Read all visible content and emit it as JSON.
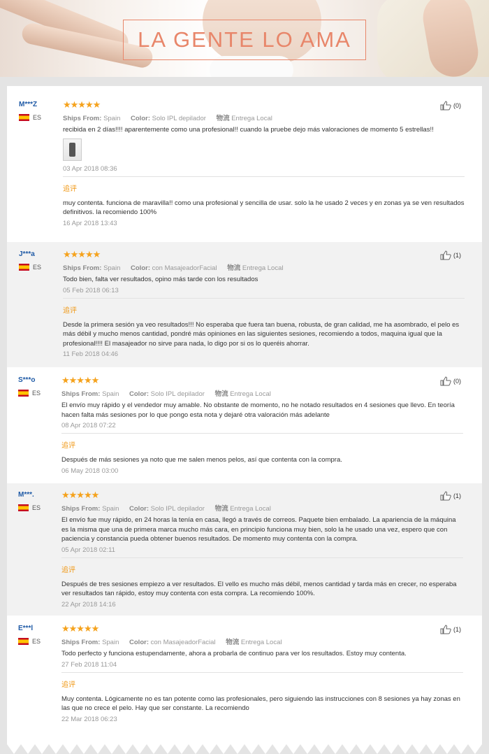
{
  "banner": {
    "title": "LA GENTE LO AMA"
  },
  "labels": {
    "ships_from": "Ships From:",
    "color": "Color:",
    "logistics": "物流",
    "followup": "追评"
  },
  "reviews": [
    {
      "user": "M***Z",
      "country": "ES",
      "stars": "★★★★★",
      "ships_from": "Spain",
      "color": "Solo IPL depilador",
      "logistics": "Entrega Local",
      "text": "recibida en 2 días!!!! aparentemente como una profesional!! cuando la pruebe dejo más valoraciones de momento 5 estrellas!!",
      "date": "03 Apr 2018 08:36",
      "likes": "(0)",
      "followup_text": "muy contenta. funciona de maravilla!! como una profesional y sencilla de usar. solo la he usado 2 veces y en zonas ya se ven resultados definitivos. la recomiendo 100%",
      "followup_date": "16 Apr 2018 13:43"
    },
    {
      "user": "J***a",
      "country": "ES",
      "stars": "★★★★★",
      "ships_from": "Spain",
      "color": "con MasajeadorFacial",
      "logistics": "Entrega Local",
      "text": "Todo bien, falta ver resultados, opino más tarde con los resultados",
      "date": "05 Feb 2018 06:13",
      "likes": "(1)",
      "followup_text": "Desde la primera sesión ya veo resultados!!! No esperaba que fuera tan buena, robusta, de gran calidad, me ha asombrado, el pelo es más débil y mucho menos cantidad, pondré más opiniones en las siguientes sesiones, recomiendo a todos, maquina igual que la profesional!!!! El masajeador no sirve para nada, lo digo por si os lo queréis ahorrar.",
      "followup_date": "11 Feb 2018 04:46"
    },
    {
      "user": "S***o",
      "country": "ES",
      "stars": "★★★★★",
      "ships_from": "Spain",
      "color": "Solo IPL depilador",
      "logistics": "Entrega Local",
      "text": "El envío muy rápido y el vendedor muy amable. No obstante de momento, no he notado resultados en 4 sesiones que llevo. En teoría hacen falta más sesiones por lo que pongo esta nota y dejaré otra valoración más adelante",
      "date": "08 Apr 2018 07:22",
      "likes": "(0)",
      "followup_text": "Después de más sesiones ya noto que me salen menos pelos, así que contenta con la compra.",
      "followup_date": "06 May 2018 03:00"
    },
    {
      "user": "M***.",
      "country": "ES",
      "stars": "★★★★★",
      "ships_from": "Spain",
      "color": "Solo IPL depilador",
      "logistics": "Entrega Local",
      "text": "El envío fue muy rápido, en 24 horas la tenía en casa, llegó a través de correos. Paquete bien embalado. La apariencia de la máquina es la misma que una de primera marca mucho más cara, en principio funciona muy bien, solo la he usado una vez, espero que con paciencia y constancia pueda obtener buenos resultados. De momento muy contenta con la compra.",
      "date": "05 Apr 2018 02:11",
      "likes": "(1)",
      "followup_text": "Después de tres sesiones empiezo a ver resultados. El vello es mucho más débil, menos cantidad y tarda más en crecer, no esperaba ver resultados tan rápido, estoy muy contenta con esta compra. La recomiendo 100%.",
      "followup_date": "22 Apr 2018 14:16"
    },
    {
      "user": "E***l",
      "country": "ES",
      "stars": "★★★★★",
      "ships_from": "Spain",
      "color": "con MasajeadorFacial",
      "logistics": "Entrega Local",
      "text": "Todo perfecto y funciona estupendamente, ahora a probarla de continuo para ver los resultados. Estoy muy contenta.",
      "date": "27 Feb 2018 11:04",
      "likes": "(1)",
      "followup_text": "Muy contenta. Lógicamente no es tan potente como las profesionales, pero siguiendo las instrucciones con 8 sesiones ya hay zonas en las que no crece el pelo. Hay que ser constante. La recomiendo",
      "followup_date": "22 Mar 2018 06:23"
    }
  ]
}
